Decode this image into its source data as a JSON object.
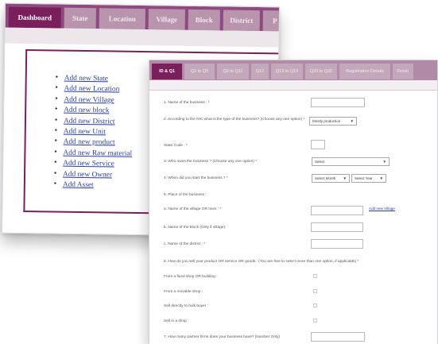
{
  "dashboard": {
    "tabs": [
      "Dashboard",
      "State",
      "Location",
      "Village",
      "Block",
      "District",
      "P"
    ],
    "links": [
      "Add new State",
      "Add new Location",
      "Add new Village",
      "Add new block",
      "Add new District",
      "Add new Unit",
      "Add new product",
      "Add new Raw material",
      "Add new Service",
      "Add new Owner",
      "Add Asset"
    ]
  },
  "form": {
    "tabs": [
      "ID & Q1",
      "Q2 to Q5",
      "Q6 to Q11",
      "Q12",
      "Q13 to Q19",
      "Q20 to Q26",
      "Registration Details",
      "Finish"
    ],
    "questions": {
      "q1": "1. Name of the business : *",
      "q2": "2. According to the NIC what is the type of the business? (Choose any one option) *",
      "q2_select": "Mostly production",
      "state_code": "State Code : *",
      "q3": "3. Who owns the business ? (Choose any one option) *",
      "q3_select": "Select",
      "q4": "4. When did you start the business ? *",
      "q4_month": "Select Month",
      "q4_year": "Select Year",
      "q5": "5. Place of the business :",
      "q5a": "a. Name of the village OR town : *",
      "q5a_link": "Add new Village",
      "q5b": "b. Name of the block (Only if village):",
      "q5c": "c. Name of the district : *",
      "q6": "6. How do you sell your product OR service OR goods : (You are free to select more than one option, if applicable) *",
      "opt1": "From a fixed shop OR building :",
      "opt2": "From a movable shop :",
      "opt3": "Sell directly to bulk buyer :",
      "opt4": "Sell in a shop :",
      "q7": "7. How many partner firms does your business have? (Number Only)"
    }
  }
}
